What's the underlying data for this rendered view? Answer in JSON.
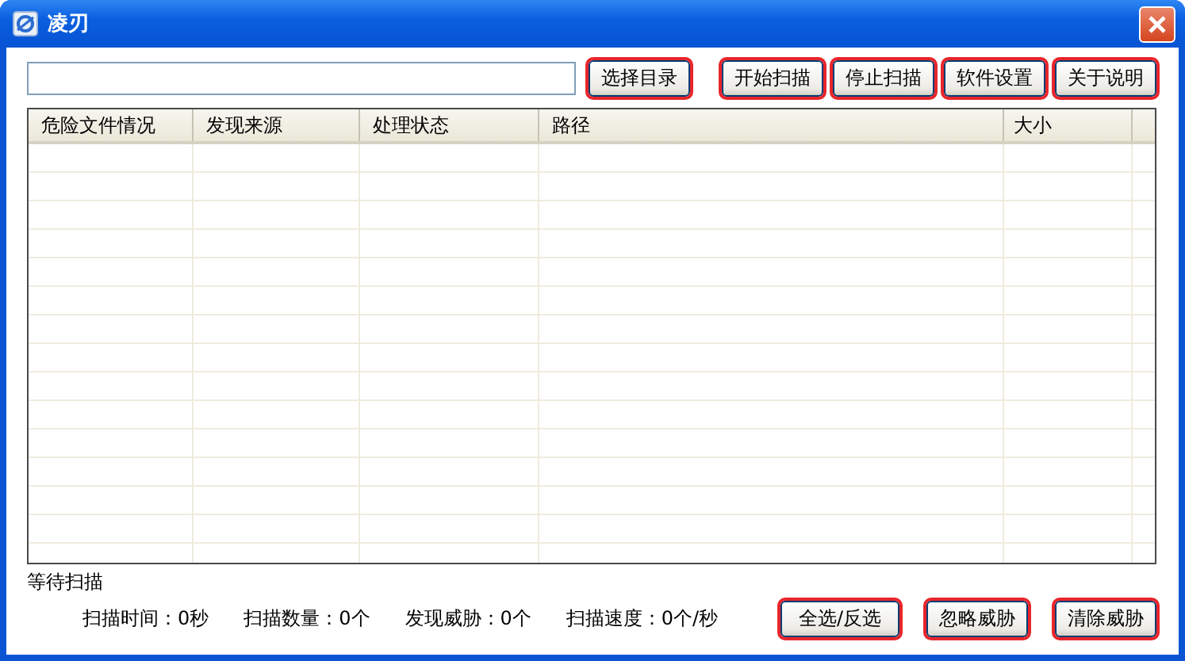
{
  "window": {
    "title": "凌刃"
  },
  "directory_button": {
    "label": "选择目录",
    "highlighted": true
  },
  "toolbar_buttons": [
    {
      "label": "开始扫描",
      "highlighted": true
    },
    {
      "label": "停止扫描",
      "highlighted": true
    },
    {
      "label": "软件设置",
      "highlighted": true
    },
    {
      "label": "关于说明",
      "highlighted": true
    }
  ],
  "table": {
    "columns": [
      "危险文件情况",
      "发现来源",
      "处理状态",
      "路径",
      "大小"
    ]
  },
  "status_text": "等待扫描",
  "stats": [
    {
      "label": "扫描时间：0秒"
    },
    {
      "label": "扫描数量：0个"
    },
    {
      "label": "发现威胁：0个"
    },
    {
      "label": "扫描速度：0个/秒"
    }
  ],
  "action_buttons": [
    {
      "label": "全选/反选",
      "highlighted": true
    },
    {
      "label": "忽略威胁",
      "highlighted": true
    },
    {
      "label": "清除威胁",
      "highlighted": true
    }
  ]
}
